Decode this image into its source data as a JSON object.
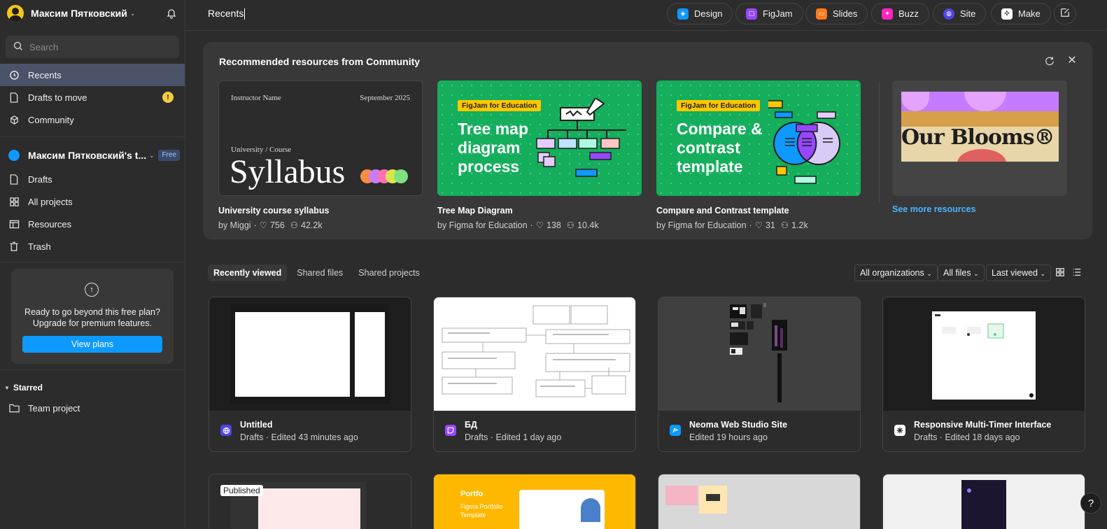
{
  "sidebar": {
    "user_name": "Максим Пятковский",
    "search_placeholder": "Search",
    "nav": [
      {
        "label": "Recents"
      },
      {
        "label": "Drafts to move",
        "badge": "!"
      },
      {
        "label": "Community"
      }
    ],
    "team": {
      "name": "Максим Пятковский's t...",
      "badge": "Free"
    },
    "team_nav": [
      {
        "label": "Drafts"
      },
      {
        "label": "All projects"
      },
      {
        "label": "Resources"
      },
      {
        "label": "Trash"
      }
    ],
    "upgrade": {
      "text": "Ready to go beyond this free plan? Upgrade for premium features.",
      "button": "View plans"
    },
    "starred": {
      "heading": "Starred",
      "items": [
        {
          "label": "Team project"
        }
      ]
    }
  },
  "topbar": {
    "title": "Recents",
    "apps": [
      {
        "label": "Design",
        "color": "#0d99ff"
      },
      {
        "label": "FigJam",
        "color": "#9747ff"
      },
      {
        "label": "Slides",
        "color": "#ff7a1a"
      },
      {
        "label": "Buzz",
        "color": "#ff24bd"
      },
      {
        "label": "Site",
        "color": "#4f46e5"
      },
      {
        "label": "Make",
        "color": "#ffffff"
      }
    ]
  },
  "recommended": {
    "title": "Recommended resources from Community",
    "cards": [
      {
        "name": "University course syllabus",
        "author": "by Miggi",
        "likes": "756",
        "users": "42.2k",
        "thumb": {
          "instructor": "Instructor Name",
          "date": "September 2025",
          "course": "University / Course",
          "big": "Syllabus"
        }
      },
      {
        "name": "Tree Map Diagram",
        "author": "by Figma for Education",
        "likes": "138",
        "users": "10.4k",
        "thumb": {
          "badge": "FigJam for Education",
          "big": "Tree map diagram process"
        }
      },
      {
        "name": "Compare and Contrast template",
        "author": "by Figma for Education",
        "likes": "31",
        "users": "1.2k",
        "thumb": {
          "badge": "FigJam for Education",
          "big": "Compare & contrast template"
        }
      }
    ],
    "bloom_text": "Our Blooms®",
    "see_more": "See more resources"
  },
  "tabs": [
    "Recently viewed",
    "Shared files",
    "Shared projects"
  ],
  "filters": {
    "org": "All organizations",
    "files": "All files",
    "sort": "Last viewed"
  },
  "files": [
    {
      "title": "Untitled",
      "sub": "Drafts · Edited 43 minutes ago",
      "type": "site"
    },
    {
      "title": "БД",
      "sub": "Drafts · Edited 1 day ago",
      "type": "figjam"
    },
    {
      "title": "Neoma Web Studio Site",
      "sub": "Edited 19 hours ago",
      "type": "design"
    },
    {
      "title": "Responsive Multi-Timer Interface",
      "sub": "Drafts · Edited 18 days ago",
      "type": "make"
    }
  ],
  "row2": {
    "published": "Published",
    "portfolio_title": "Portfo",
    "portfolio_sub": "Figma Portfolio Template"
  },
  "help": "?"
}
